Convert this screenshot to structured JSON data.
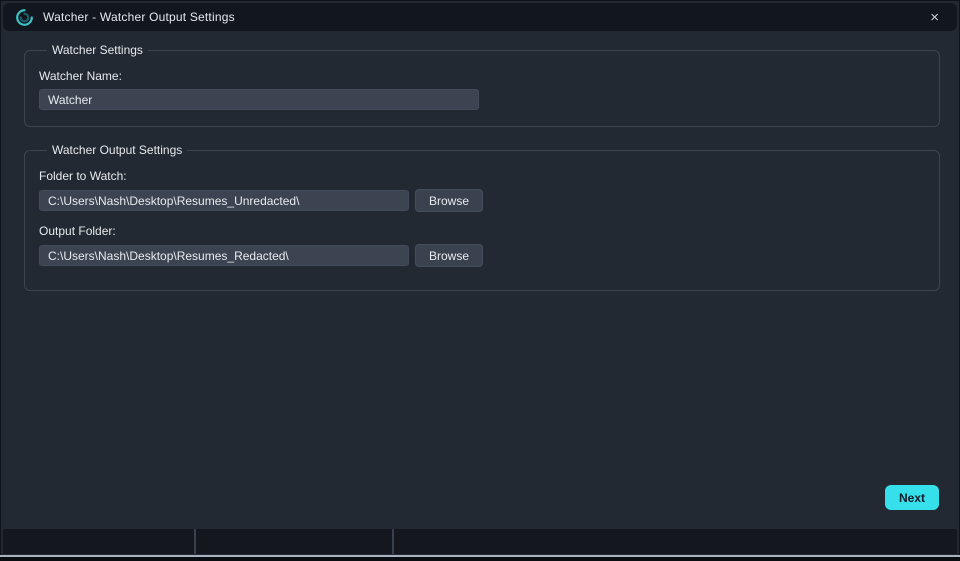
{
  "window": {
    "title": "Watcher - Watcher Output Settings",
    "close_label": "×"
  },
  "watcher_settings": {
    "legend": "Watcher Settings",
    "name_label": "Watcher Name:",
    "name_value": "Watcher"
  },
  "output_settings": {
    "legend": "Watcher Output Settings",
    "folder_to_watch_label": "Folder to Watch:",
    "folder_to_watch_value": "C:\\Users\\Nash\\Desktop\\Resumes_Unredacted\\",
    "browse_watch_label": "Browse",
    "output_folder_label": "Output Folder:",
    "output_folder_value": "C:\\Users\\Nash\\Desktop\\Resumes_Redacted\\",
    "browse_output_label": "Browse"
  },
  "footer": {
    "next_label": "Next"
  },
  "colors": {
    "accent_cyan": "#35e0ea",
    "titlebar_bg": "#12161e",
    "content_bg": "#232933",
    "input_bg": "#3c4452",
    "statusbar_bg": "#14171e",
    "icon_teal": "#3fc2c4"
  }
}
